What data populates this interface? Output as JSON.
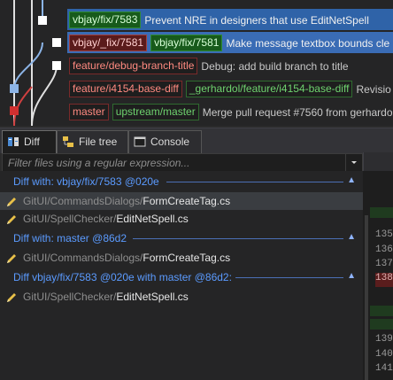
{
  "graph": {
    "rows": [
      {
        "refs": [],
        "message": ""
      },
      {
        "refs": [
          {
            "text": "vbjay/fix/7583",
            "kind": "remote-sel"
          }
        ],
        "message": "Prevent NRE in designers that use EditNetSpell"
      },
      {
        "refs": [
          {
            "text": "vbjay/_fix/7581",
            "kind": "local-sel"
          },
          {
            "text": "vbjay/fix/7581",
            "kind": "remote-sel"
          }
        ],
        "message": "Make message textbox bounds cle"
      },
      {
        "refs": [
          {
            "text": "feature/debug-branch-title",
            "kind": "local"
          }
        ],
        "message": "Debug: add build branch to title"
      },
      {
        "refs": [
          {
            "text": "feature/i4154-base-diff",
            "kind": "local"
          },
          {
            "text": "_gerhardol/feature/i4154-base-diff",
            "kind": "remote"
          }
        ],
        "message": "Revisio"
      },
      {
        "refs": [
          {
            "text": "master",
            "kind": "local"
          },
          {
            "text": "upstream/master",
            "kind": "remote"
          }
        ],
        "message": "Merge pull request #7560 from gerhardo"
      }
    ]
  },
  "tabs": [
    {
      "label": "Diff",
      "icon": "diff-icon",
      "active": true
    },
    {
      "label": "File tree",
      "icon": "file-tree-icon",
      "active": false
    },
    {
      "label": "Console",
      "icon": "console-icon",
      "active": false
    }
  ],
  "filter": {
    "placeholder": "Filter files using a regular expression...",
    "value": ""
  },
  "groups": [
    {
      "label": "Diff with: vbjay/fix/7583 @020e",
      "files": [
        {
          "dir": "GitUI/CommandsDialogs/",
          "name": "FormCreateTag.cs",
          "selected": true
        },
        {
          "dir": "GitUI/SpellChecker/",
          "name": "EditNetSpell.cs",
          "selected": false
        }
      ]
    },
    {
      "label": "Diff with: master @86d2",
      "files": [
        {
          "dir": "GitUI/CommandsDialogs/",
          "name": "FormCreateTag.cs",
          "selected": false
        }
      ]
    },
    {
      "label": "Diff vbjay/fix/7583 @020e with master @86d2:",
      "files": [
        {
          "dir": "GitUI/SpellChecker/",
          "name": "EditNetSpell.cs",
          "selected": false
        }
      ]
    }
  ],
  "line_numbers": [
    "135",
    "136",
    "137",
    "138",
    "139",
    "140",
    "141"
  ]
}
